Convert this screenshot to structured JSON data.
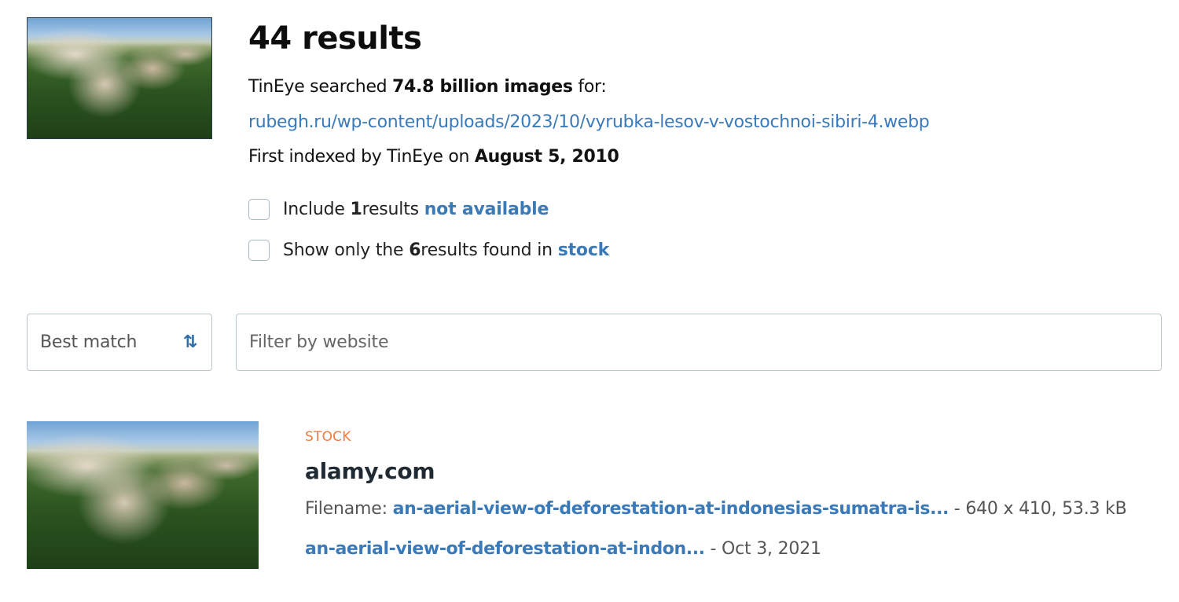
{
  "query": {
    "thumbnail_alt": "aerial view of deforestation",
    "results_title": "44 results",
    "searched_prefix": "TinEye searched ",
    "searched_count": "74.8 billion images",
    "searched_suffix": " for:",
    "image_url": "rubegh.ru/wp-content/uploads/2023/10/vyrubka-lesov-v-vostochnoi-sibiri-4.webp",
    "first_indexed_prefix": "First indexed by TinEye on ",
    "first_indexed_date": "August 5, 2010"
  },
  "filters": {
    "include_prefix": "Include ",
    "include_count": "1",
    "include_middle": " results ",
    "include_link": "not available",
    "stock_prefix": "Show only the ",
    "stock_count": "6",
    "stock_middle": " results found in ",
    "stock_link": "stock"
  },
  "controls": {
    "sort_label": "Best match",
    "sort_icon": "sort-arrows-icon",
    "filter_placeholder": "Filter by website"
  },
  "results": [
    {
      "badge": "STOCK",
      "domain": "alamy.com",
      "filename_label": "Filename: ",
      "filename": "an-aerial-view-of-deforestation-at-indonesias-sumatra-is...",
      "dims": " - 640 x 410, 53.3 kB",
      "page_link": "an-aerial-view-of-deforestation-at-indon...",
      "date": " - Oct 3, 2021"
    }
  ],
  "colors": {
    "link": "#3b7ab8",
    "badge": "#f07b3f"
  }
}
